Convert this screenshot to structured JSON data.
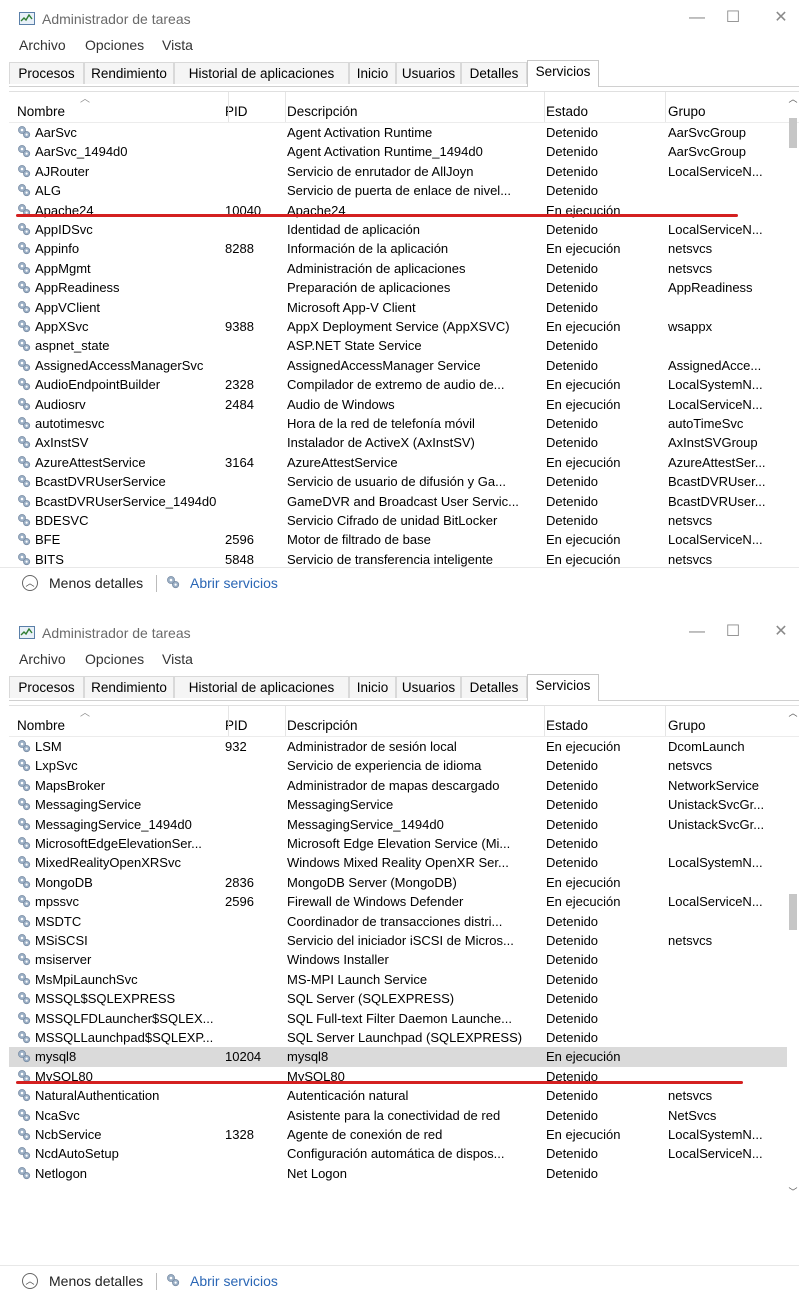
{
  "windows": [
    {
      "title": "Administrador de tareas",
      "menu": [
        "Archivo",
        "Opciones",
        "Vista"
      ],
      "tabs": [
        "Procesos",
        "Rendimiento",
        "Historial de aplicaciones",
        "Inicio",
        "Usuarios",
        "Detalles",
        "Servicios"
      ],
      "active_tab": "Servicios",
      "columns": [
        "Nombre",
        "PID",
        "Descripción",
        "Estado",
        "Grupo"
      ],
      "rows": [
        {
          "name": "AarSvc",
          "pid": "",
          "desc": "Agent Activation Runtime",
          "status": "Detenido",
          "group": "AarSvcGroup"
        },
        {
          "name": "AarSvc_1494d0",
          "pid": "",
          "desc": "Agent Activation Runtime_1494d0",
          "status": "Detenido",
          "group": "AarSvcGroup"
        },
        {
          "name": "AJRouter",
          "pid": "",
          "desc": "Servicio de enrutador de AllJoyn",
          "status": "Detenido",
          "group": "LocalServiceN..."
        },
        {
          "name": "ALG",
          "pid": "",
          "desc": "Servicio de puerta de enlace de nivel...",
          "status": "Detenido",
          "group": ""
        },
        {
          "name": "Apache24",
          "pid": "10040",
          "desc": "Apache24",
          "status": "En ejecución",
          "group": ""
        },
        {
          "name": "AppIDSvc",
          "pid": "",
          "desc": "Identidad de aplicación",
          "status": "Detenido",
          "group": "LocalServiceN..."
        },
        {
          "name": "Appinfo",
          "pid": "8288",
          "desc": "Información de la aplicación",
          "status": "En ejecución",
          "group": "netsvcs"
        },
        {
          "name": "AppMgmt",
          "pid": "",
          "desc": "Administración de aplicaciones",
          "status": "Detenido",
          "group": "netsvcs"
        },
        {
          "name": "AppReadiness",
          "pid": "",
          "desc": "Preparación de aplicaciones",
          "status": "Detenido",
          "group": "AppReadiness"
        },
        {
          "name": "AppVClient",
          "pid": "",
          "desc": "Microsoft App-V Client",
          "status": "Detenido",
          "group": ""
        },
        {
          "name": "AppXSvc",
          "pid": "9388",
          "desc": "AppX Deployment Service (AppXSVC)",
          "status": "En ejecución",
          "group": "wsappx"
        },
        {
          "name": "aspnet_state",
          "pid": "",
          "desc": "ASP.NET State Service",
          "status": "Detenido",
          "group": ""
        },
        {
          "name": "AssignedAccessManagerSvc",
          "pid": "",
          "desc": "AssignedAccessManager Service",
          "status": "Detenido",
          "group": "AssignedAcce..."
        },
        {
          "name": "AudioEndpointBuilder",
          "pid": "2328",
          "desc": "Compilador de extremo de audio de...",
          "status": "En ejecución",
          "group": "LocalSystemN..."
        },
        {
          "name": "Audiosrv",
          "pid": "2484",
          "desc": "Audio de Windows",
          "status": "En ejecución",
          "group": "LocalServiceN..."
        },
        {
          "name": "autotimesvc",
          "pid": "",
          "desc": "Hora de la red de telefonía móvil",
          "status": "Detenido",
          "group": "autoTimeSvc"
        },
        {
          "name": "AxInstSV",
          "pid": "",
          "desc": "Instalador de ActiveX (AxInstSV)",
          "status": "Detenido",
          "group": "AxInstSVGroup"
        },
        {
          "name": "AzureAttestService",
          "pid": "3164",
          "desc": "AzureAttestService",
          "status": "En ejecución",
          "group": "AzureAttestSer..."
        },
        {
          "name": "BcastDVRUserService",
          "pid": "",
          "desc": "Servicio de usuario de difusión y Ga...",
          "status": "Detenido",
          "group": "BcastDVRUser..."
        },
        {
          "name": "BcastDVRUserService_1494d0",
          "pid": "",
          "desc": "GameDVR and Broadcast User Servic...",
          "status": "Detenido",
          "group": "BcastDVRUser..."
        },
        {
          "name": "BDESVC",
          "pid": "",
          "desc": "Servicio Cifrado de unidad BitLocker",
          "status": "Detenido",
          "group": "netsvcs"
        },
        {
          "name": "BFE",
          "pid": "2596",
          "desc": "Motor de filtrado de base",
          "status": "En ejecución",
          "group": "LocalServiceN..."
        },
        {
          "name": "BITS",
          "pid": "5848",
          "desc": "Servicio de transferencia inteligente",
          "status": "En ejecución",
          "group": "netsvcs"
        }
      ],
      "footer": {
        "fewer_details": "Menos detalles",
        "open_services": "Abrir servicios"
      }
    },
    {
      "title": "Administrador de tareas",
      "menu": [
        "Archivo",
        "Opciones",
        "Vista"
      ],
      "tabs": [
        "Procesos",
        "Rendimiento",
        "Historial de aplicaciones",
        "Inicio",
        "Usuarios",
        "Detalles",
        "Servicios"
      ],
      "active_tab": "Servicios",
      "columns": [
        "Nombre",
        "PID",
        "Descripción",
        "Estado",
        "Grupo"
      ],
      "rows": [
        {
          "name": "LSM",
          "pid": "932",
          "desc": "Administrador de sesión local",
          "status": "En ejecución",
          "group": "DcomLaunch"
        },
        {
          "name": "LxpSvc",
          "pid": "",
          "desc": "Servicio de experiencia de idioma",
          "status": "Detenido",
          "group": "netsvcs"
        },
        {
          "name": "MapsBroker",
          "pid": "",
          "desc": "Administrador de mapas descargado",
          "status": "Detenido",
          "group": "NetworkService"
        },
        {
          "name": "MessagingService",
          "pid": "",
          "desc": "MessagingService",
          "status": "Detenido",
          "group": "UnistackSvcGr..."
        },
        {
          "name": "MessagingService_1494d0",
          "pid": "",
          "desc": "MessagingService_1494d0",
          "status": "Detenido",
          "group": "UnistackSvcGr..."
        },
        {
          "name": "MicrosoftEdgeElevationSer...",
          "pid": "",
          "desc": "Microsoft Edge Elevation Service (Mi...",
          "status": "Detenido",
          "group": ""
        },
        {
          "name": "MixedRealityOpenXRSvc",
          "pid": "",
          "desc": "Windows Mixed Reality OpenXR Ser...",
          "status": "Detenido",
          "group": "LocalSystemN..."
        },
        {
          "name": "MongoDB",
          "pid": "2836",
          "desc": "MongoDB Server (MongoDB)",
          "status": "En ejecución",
          "group": ""
        },
        {
          "name": "mpssvc",
          "pid": "2596",
          "desc": "Firewall de Windows Defender",
          "status": "En ejecución",
          "group": "LocalServiceN..."
        },
        {
          "name": "MSDTC",
          "pid": "",
          "desc": "Coordinador de transacciones distri...",
          "status": "Detenido",
          "group": ""
        },
        {
          "name": "MSiSCSI",
          "pid": "",
          "desc": "Servicio del iniciador iSCSI de Micros...",
          "status": "Detenido",
          "group": "netsvcs"
        },
        {
          "name": "msiserver",
          "pid": "",
          "desc": "Windows Installer",
          "status": "Detenido",
          "group": ""
        },
        {
          "name": "MsMpiLaunchSvc",
          "pid": "",
          "desc": "MS-MPI Launch Service",
          "status": "Detenido",
          "group": ""
        },
        {
          "name": "MSSQL$SQLEXPRESS",
          "pid": "",
          "desc": "SQL Server (SQLEXPRESS)",
          "status": "Detenido",
          "group": ""
        },
        {
          "name": "MSSQLFDLauncher$SQLEX...",
          "pid": "",
          "desc": "SQL Full-text Filter Daemon Launche...",
          "status": "Detenido",
          "group": ""
        },
        {
          "name": "MSSQLLaunchpad$SQLEXP...",
          "pid": "",
          "desc": "SQL Server Launchpad (SQLEXPRESS)",
          "status": "Detenido",
          "group": ""
        },
        {
          "name": "mysql8",
          "pid": "10204",
          "desc": "mysql8",
          "status": "En ejecución",
          "group": ""
        },
        {
          "name": "MySQL80",
          "pid": "",
          "desc": "MySQL80",
          "status": "Detenido",
          "group": ""
        },
        {
          "name": "NaturalAuthentication",
          "pid": "",
          "desc": "Autenticación natural",
          "status": "Detenido",
          "group": "netsvcs"
        },
        {
          "name": "NcaSvc",
          "pid": "",
          "desc": "Asistente para la conectividad de red",
          "status": "Detenido",
          "group": "NetSvcs"
        },
        {
          "name": "NcbService",
          "pid": "1328",
          "desc": "Agente de conexión de red",
          "status": "En ejecución",
          "group": "LocalSystemN..."
        },
        {
          "name": "NcdAutoSetup",
          "pid": "",
          "desc": "Configuración automática de dispos...",
          "status": "Detenido",
          "group": "LocalServiceN..."
        },
        {
          "name": "Netlogon",
          "pid": "",
          "desc": "Net Logon",
          "status": "Detenido",
          "group": ""
        }
      ],
      "selected_row": "mysql8",
      "footer": {
        "fewer_details": "Menos detalles",
        "open_services": "Abrir servicios"
      }
    }
  ],
  "colors": {
    "annotation_red": "#d42020",
    "link_blue": "#2a66b5",
    "selected_row": "#dadada"
  },
  "icons": {
    "app": "task-manager-icon",
    "service": "gear-icon",
    "fewer": "chevron-up-icon",
    "open": "services-icon"
  }
}
